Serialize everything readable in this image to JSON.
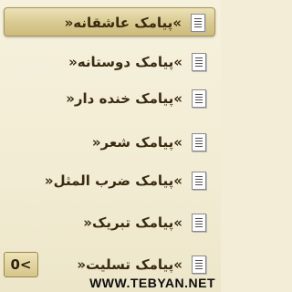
{
  "menu": {
    "items": [
      {
        "label": "»پیامک عاشقانه«",
        "icon": "document-icon",
        "selected": true
      },
      {
        "label": "»پیامک دوستانه«",
        "icon": "document-icon",
        "selected": false
      },
      {
        "label": "»پیامک خنده دار«",
        "icon": "document-icon",
        "selected": false
      },
      {
        "label": "»پیامک شعر«",
        "icon": "document-icon",
        "selected": false
      },
      {
        "label": "»پیامک ضرب المثل«",
        "icon": "document-icon",
        "selected": false
      },
      {
        "label": "»پیامک تبریک«",
        "icon": "document-icon",
        "selected": false
      },
      {
        "label": "»پیامک تسلیت«",
        "icon": "document-icon",
        "selected": false
      }
    ]
  },
  "softkey": {
    "label": "0<"
  },
  "watermark": {
    "text": "WWW.TEBYAN.NET"
  },
  "colors": {
    "background": "#f3edd7",
    "highlight": "#d8c98f",
    "text": "#3a2a10"
  }
}
